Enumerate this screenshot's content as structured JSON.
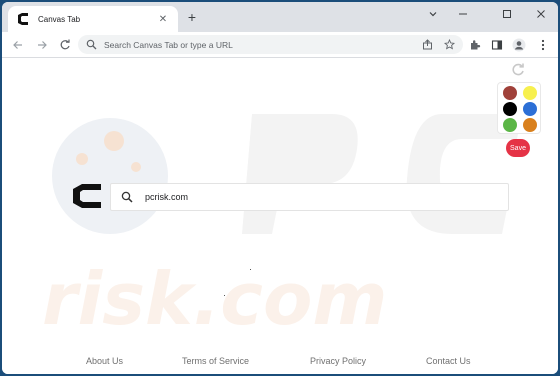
{
  "tab": {
    "title": "Canvas Tab",
    "close_icon": "close-icon"
  },
  "toolbar": {
    "omnibox_placeholder": "Search Canvas Tab or type a URL"
  },
  "search": {
    "value": "pcrisk.com"
  },
  "palette": {
    "colors": [
      "#a0413a",
      "#f7f04e",
      "#000000",
      "#2c6fd6",
      "#5bb646",
      "#d9801d"
    ],
    "save_label": "Save"
  },
  "footer": {
    "links": [
      "About Us",
      "Terms of Service",
      "Privacy Policy",
      "Contact Us"
    ]
  },
  "colors": {
    "accent": "#e53346",
    "frame": "#dee1e6",
    "omnibox": "#f1f3f4"
  }
}
